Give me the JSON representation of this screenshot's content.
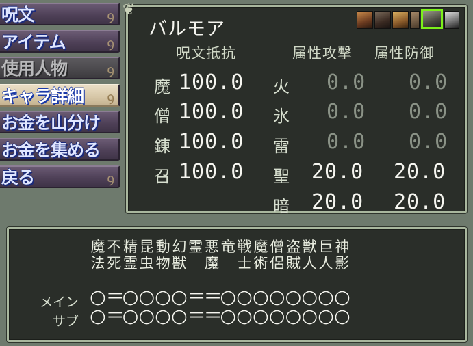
{
  "menu": {
    "items": [
      {
        "label": "呪文",
        "state": "normal"
      },
      {
        "label": "アイテム",
        "state": "normal"
      },
      {
        "label": "使用人物",
        "state": "disabled"
      },
      {
        "label": "キャラ詳細",
        "state": "active"
      },
      {
        "label": "お金を山分け",
        "state": "normal"
      },
      {
        "label": "お金を集める",
        "state": "normal"
      },
      {
        "label": "戻る",
        "state": "normal"
      }
    ]
  },
  "character": {
    "name": "バルモア",
    "party_portraits": [
      "portrait-1",
      "portrait-2",
      "portrait-3",
      "portrait-4",
      "portrait-5",
      "portrait-6"
    ],
    "selected_portrait": 5,
    "selected_color": "#7cf01a"
  },
  "resist": {
    "header": "呪文抵抗",
    "rows": [
      {
        "school": "魔",
        "value": "100.0"
      },
      {
        "school": "僧",
        "value": "100.0"
      },
      {
        "school": "錬",
        "value": "100.0"
      },
      {
        "school": "召",
        "value": "100.0"
      }
    ]
  },
  "element": {
    "attack_header": "属性攻撃",
    "defense_header": "属性防御",
    "rows": [
      {
        "element": "火",
        "attack": "0.0",
        "defense": "0.0",
        "active": false
      },
      {
        "element": "氷",
        "attack": "0.0",
        "defense": "0.0",
        "active": false
      },
      {
        "element": "雷",
        "attack": "0.0",
        "defense": "0.0",
        "active": false
      },
      {
        "element": "聖",
        "attack": "20.0",
        "defense": "20.0",
        "active": true
      },
      {
        "element": "暗",
        "attack": "20.0",
        "defense": "20.0",
        "active": true
      }
    ]
  },
  "affinity": {
    "categories_top": [
      "魔",
      "不",
      "精",
      "昆",
      "動",
      "幻",
      "霊",
      "悪",
      "竜",
      "戦",
      "魔",
      "僧",
      "盗",
      "獣",
      "巨",
      "神"
    ],
    "categories_bottom": [
      "法",
      "死",
      "霊",
      "虫",
      "物",
      "獣",
      "",
      "魔",
      "",
      "士",
      "術",
      "侶",
      "賊",
      "人",
      "人",
      "影"
    ],
    "main_label": "メイン",
    "sub_label": "サブ",
    "main_marks": [
      "○",
      "＝",
      "○",
      "○",
      "○",
      "○",
      "＝",
      "＝",
      "○",
      "○",
      "○",
      "○",
      "○",
      "○",
      "○",
      "○"
    ],
    "sub_marks": [
      "○",
      "＝",
      "○",
      "○",
      "○",
      "○",
      "＝",
      "＝",
      "○",
      "○",
      "○",
      "○",
      "○",
      "○",
      "○",
      "○"
    ]
  }
}
